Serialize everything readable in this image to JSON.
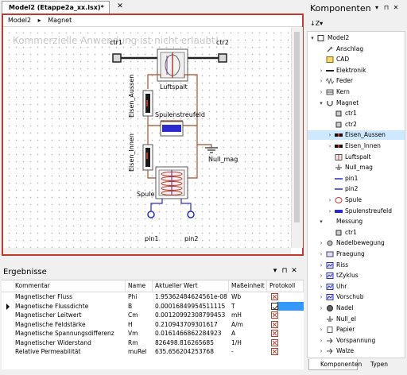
{
  "document": {
    "tab_title": "Model2 (Etappe2a_xx.isx)*",
    "tab_close": "✕",
    "breadcrumb": [
      "Model2",
      "Magnet"
    ],
    "breadcrumb_sep": "▸",
    "watermark": "Kommerzielle Anwendung ist nicht erlaubt!"
  },
  "diagram": {
    "labels": {
      "ctr1": "ctr1",
      "ctr2": "ctr2",
      "luftspalt": "Luftspalt",
      "eisen_aussen": "Eisen_Aussen",
      "eisen_innen": "Eisen_Innen",
      "spulenstreufeld": "Spulenstreufeld",
      "null_mag": "Null_mag",
      "spule": "Spule",
      "pin1": "pin1",
      "pin2": "pin2"
    }
  },
  "results": {
    "title": "Ergebnisse",
    "panel_buttons": [
      "▾",
      "⊓",
      "✕"
    ],
    "columns": [
      "Kommentar",
      "Name",
      "Aktueller Wert",
      "Maßeinheit",
      "Protokoll"
    ],
    "rows": [
      {
        "kommentar": "Magnetischer Fluss",
        "name": "Phi",
        "wert": "1.95362484624561e-08",
        "einheit": "Wb",
        "protokoll": false
      },
      {
        "kommentar": "Magnetische Flussdichte",
        "name": "B",
        "wert": "0.00016849954511115",
        "einheit": "T",
        "protokoll": true
      },
      {
        "kommentar": "Magnetischer Leitwert",
        "name": "Cm",
        "wert": "0.00120992308799453",
        "einheit": "mH",
        "protokoll": false
      },
      {
        "kommentar": "Magnetische Feldstärke",
        "name": "H",
        "wert": "0.210943709301617",
        "einheit": "A/m",
        "protokoll": false
      },
      {
        "kommentar": "Magnetische Spannungsdifferenz",
        "name": "Vm",
        "wert": "0.0161466862284923",
        "einheit": "A",
        "protokoll": false
      },
      {
        "kommentar": "Magnetischer Widerstand",
        "name": "Rm",
        "wert": "826498.816265685",
        "einheit": "1/H",
        "protokoll": false
      },
      {
        "kommentar": "Relative Permeabilität",
        "name": "muRel",
        "wert": "635.656204253768",
        "einheit": "-",
        "protokoll": false
      }
    ]
  },
  "components": {
    "title": "Komponenten",
    "panel_buttons": [
      "▾",
      "⊓",
      "✕"
    ],
    "sort_icon": "↓Z▾",
    "tree": [
      {
        "label": "Model2",
        "level": 0,
        "twisty": "▾",
        "icon": "box"
      },
      {
        "label": "Anschlag",
        "level": 1,
        "twisty": "",
        "icon": "wrench"
      },
      {
        "label": "CAD",
        "level": 1,
        "twisty": "",
        "icon": "cad"
      },
      {
        "label": "Elektronik",
        "level": 1,
        "twisty": "›",
        "icon": "line"
      },
      {
        "label": "Feder",
        "level": 1,
        "twisty": "›",
        "icon": "spring"
      },
      {
        "label": "Kern",
        "level": 1,
        "twisty": "›",
        "icon": "core"
      },
      {
        "label": "Magnet",
        "level": 1,
        "twisty": "▾",
        "icon": "magnet"
      },
      {
        "label": "ctr1",
        "level": 2,
        "twisty": "",
        "icon": "pin"
      },
      {
        "label": "ctr2",
        "level": 2,
        "twisty": "",
        "icon": "pin"
      },
      {
        "label": "Eisen_Aussen",
        "level": 2,
        "twisty": "›",
        "icon": "bar",
        "selected": true
      },
      {
        "label": "Eisen_Innen",
        "level": 2,
        "twisty": "›",
        "icon": "bar"
      },
      {
        "label": "Luftspalt",
        "level": 2,
        "twisty": "",
        "icon": "gap"
      },
      {
        "label": "Null_mag",
        "level": 2,
        "twisty": "",
        "icon": "ground"
      },
      {
        "label": "pin1",
        "level": 2,
        "twisty": "",
        "icon": "bluepin"
      },
      {
        "label": "pin2",
        "level": 2,
        "twisty": "",
        "icon": "bluepin"
      },
      {
        "label": "Spule",
        "level": 2,
        "twisty": "›",
        "icon": "coil"
      },
      {
        "label": "Spulenstreufeld",
        "level": 2,
        "twisty": "›",
        "icon": "bluebar"
      },
      {
        "label": "Messung",
        "level": 1,
        "twisty": "▾",
        "icon": "none"
      },
      {
        "label": "ctr1",
        "level": 2,
        "twisty": "",
        "icon": "pin"
      },
      {
        "label": "Nadelbewegung",
        "level": 1,
        "twisty": "›",
        "icon": "gear"
      },
      {
        "label": "Praegung",
        "level": 1,
        "twisty": "›",
        "icon": "stamp"
      },
      {
        "label": "Riss",
        "level": 1,
        "twisty": "›",
        "icon": "chart"
      },
      {
        "label": "tZyklus",
        "level": 1,
        "twisty": "›",
        "icon": "chart"
      },
      {
        "label": "Uhr",
        "level": 1,
        "twisty": "›",
        "icon": "chart"
      },
      {
        "label": "Vorschub",
        "level": 1,
        "twisty": "›",
        "icon": "chart"
      },
      {
        "label": "Nadel",
        "level": 1,
        "twisty": "›",
        "icon": "ball"
      },
      {
        "label": "Null_el",
        "level": 1,
        "twisty": "",
        "icon": "ground"
      },
      {
        "label": "Papier",
        "level": 1,
        "twisty": "›",
        "icon": "paper"
      },
      {
        "label": "Vorspannung",
        "level": 1,
        "twisty": "›",
        "icon": "arrow"
      },
      {
        "label": "Walze",
        "level": 1,
        "twisty": "›",
        "icon": "arrow"
      }
    ],
    "tabs": [
      "Komponenten",
      "Typen"
    ]
  }
}
